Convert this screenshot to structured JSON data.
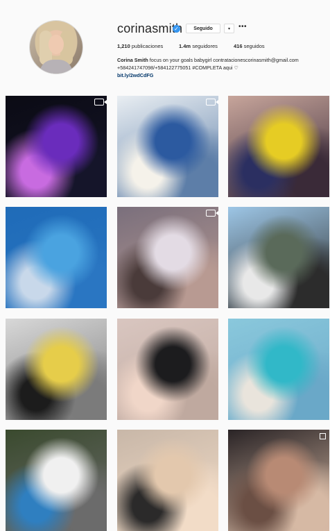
{
  "profile": {
    "username": "corinasmith",
    "verified": true,
    "follow_button": "Seguido",
    "dropdown_icon": "chevron-down-icon",
    "more_icon": "ellipsis-icon",
    "more_label": "•••",
    "dropdown_label": "▾",
    "verified_label": "✓",
    "stats": {
      "posts_count": "1,210",
      "posts_label": " publicaciones",
      "followers_count": "1.4m",
      "followers_label": " seguidores",
      "following_count": "416",
      "following_label": " seguidos"
    },
    "bio": {
      "name": "Corina Smith",
      "text": " focus on your goals babygirl contratacionescorinasmith@gmail.com +584241747098/+584122775051 #COMPLETA aqui ♡",
      "link": "bit.ly/2wdCdFG"
    }
  },
  "posts": [
    {
      "name": "post-concert-stage",
      "colors": [
        "#0b0b14",
        "#6a2cbc",
        "#c86be0",
        "#15152a"
      ],
      "badge": "video"
    },
    {
      "name": "post-ascap-event",
      "colors": [
        "#e9eef2",
        "#2c5aa0",
        "#f5f2ea",
        "#5d7ea8"
      ],
      "badge": "video"
    },
    {
      "name": "post-yellow-sweatshirt",
      "colors": [
        "#c7a59b",
        "#e6cc24",
        "#2b2f61",
        "#3a2a38"
      ],
      "badge": ""
    },
    {
      "name": "post-blue-strings",
      "colors": [
        "#1f6bb8",
        "#4aa3e0",
        "#c8d8ea",
        "#2a76c2"
      ],
      "badge": ""
    },
    {
      "name": "post-crowd-concert",
      "colors": [
        "#7a6f7c",
        "#e3dbe4",
        "#4a3b3a",
        "#b89a92"
      ],
      "badge": "video"
    },
    {
      "name": "post-airplane",
      "colors": [
        "#9dc6e6",
        "#5a6a5a",
        "#e8e8e8",
        "#2c2c2c"
      ],
      "badge": ""
    },
    {
      "name": "post-yellow-coat",
      "colors": [
        "#d8d8d8",
        "#e6cd4a",
        "#1c1c1c",
        "#7b7b7b"
      ],
      "badge": ""
    },
    {
      "name": "post-black-hoodie",
      "colors": [
        "#d9c6c0",
        "#1c1c1e",
        "#f0d6c8",
        "#bfa99f"
      ],
      "badge": ""
    },
    {
      "name": "post-beach",
      "colors": [
        "#8ac8dc",
        "#31b8c8",
        "#e9e4dc",
        "#6aa8c8"
      ],
      "badge": ""
    },
    {
      "name": "post-street",
      "colors": [
        "#3a4a2e",
        "#f0f0f0",
        "#2f7fc0",
        "#6b6b6b"
      ],
      "badge": ""
    },
    {
      "name": "post-smiling-selfie",
      "colors": [
        "#c8b7a8",
        "#e3c8ad",
        "#2b2a2a",
        "#f2dcc7"
      ],
      "badge": ""
    },
    {
      "name": "post-group-photo",
      "colors": [
        "#2a2426",
        "#b88a74",
        "#6b4f44",
        "#d6b9a4"
      ],
      "badge": "multi"
    }
  ]
}
